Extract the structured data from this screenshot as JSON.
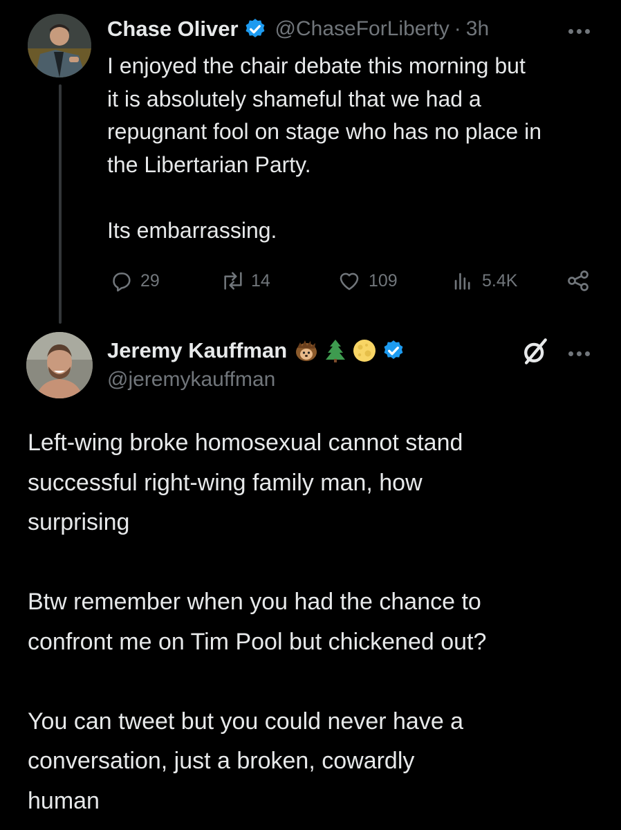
{
  "parent_tweet": {
    "author_name": "Chase Oliver",
    "handle": "@ChaseForLiberty",
    "separator": "·",
    "timestamp": "3h",
    "text": "I enjoyed the chair debate this morning but\nit is absolutely shameful that we had a\nrepugnant fool on stage who has no place in\nthe Libertarian Party.\n\nIts embarrassing.",
    "stats": {
      "replies": "29",
      "reposts": "14",
      "likes": "109",
      "views": "5.4K"
    }
  },
  "reply_tweet": {
    "author_name": "Jeremy Kauffman",
    "name_emojis": [
      "hedgehog-emoji",
      "evergreen-tree-emoji",
      "full-moon-emoji"
    ],
    "handle": "@jeremykauffman",
    "text": "Left-wing broke homosexual cannot stand\nsuccessful right-wing family man, how\nsurprising\n\nBtw remember when you had the chance to\nconfront me on Tim Pool but chickened out?\n\nYou can tweet but you could never have a\nconversation, just a broken, cowardly\nhuman"
  },
  "colors": {
    "background": "#000000",
    "primary_text": "#e7e9ea",
    "secondary_text": "#71767b",
    "verified_blue": "#1d9bf0",
    "thread_line": "#333639"
  }
}
